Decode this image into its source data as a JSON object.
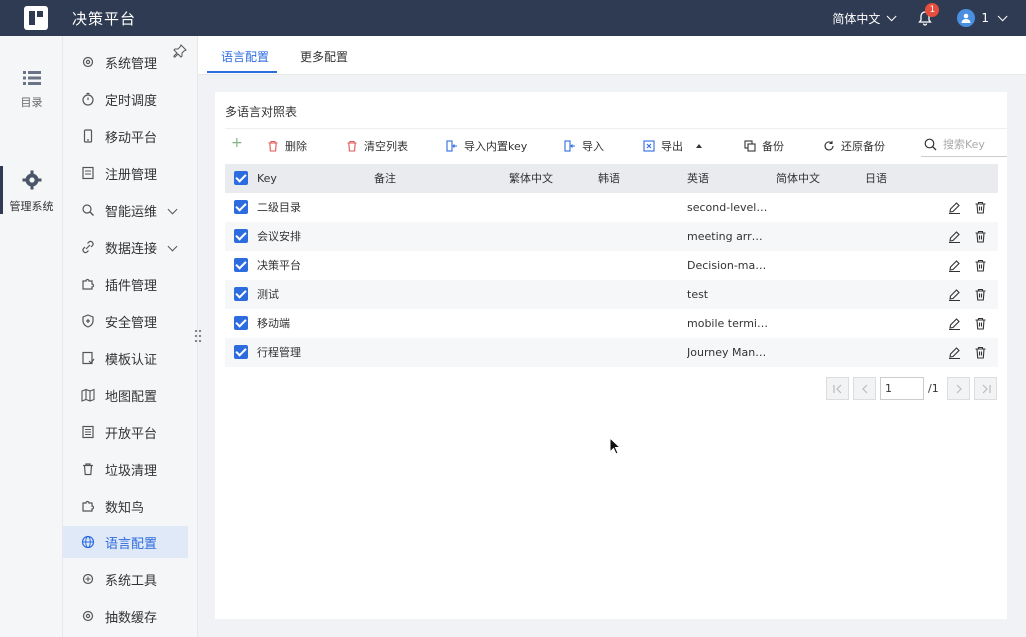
{
  "app": {
    "title": "决策平台"
  },
  "topbar": {
    "language": "简体中文",
    "notification_count": "1",
    "user_name": "1"
  },
  "rail": {
    "items": [
      {
        "label": "目录",
        "icon": "list-icon"
      },
      {
        "label": "管理系统",
        "icon": "gear-icon"
      }
    ]
  },
  "submenu": {
    "items": [
      {
        "label": "系统管理",
        "icon": "gear-icon"
      },
      {
        "label": "定时调度",
        "icon": "stopwatch-icon"
      },
      {
        "label": "移动平台",
        "icon": "mobile-icon"
      },
      {
        "label": "注册管理",
        "icon": "register-icon"
      },
      {
        "label": "智能运维",
        "icon": "ops-icon"
      },
      {
        "label": "数据连接",
        "icon": "link-icon"
      },
      {
        "label": "插件管理",
        "icon": "puzzle-icon"
      },
      {
        "label": "安全管理",
        "icon": "shield-icon"
      },
      {
        "label": "模板认证",
        "icon": "template-icon"
      },
      {
        "label": "地图配置",
        "icon": "map-icon"
      },
      {
        "label": "开放平台",
        "icon": "open-icon"
      },
      {
        "label": "垃圾清理",
        "icon": "trash-icon"
      },
      {
        "label": "数知鸟",
        "icon": "bird-icon"
      },
      {
        "label": "语言配置",
        "icon": "globe-icon"
      },
      {
        "label": "系统工具",
        "icon": "tool-icon"
      },
      {
        "label": "抽数缓存",
        "icon": "cache-icon"
      }
    ]
  },
  "tabs": [
    {
      "label": "语言配置"
    },
    {
      "label": "更多配置"
    }
  ],
  "panel": {
    "title": "多语言对照表"
  },
  "toolbar": {
    "add": "+",
    "delete": "删除",
    "clear": "清空列表",
    "import_builtin": "导入内置key",
    "import": "导入",
    "export": "导出",
    "backup": "备份",
    "restore": "还原备份",
    "search_placeholder": "搜索Key"
  },
  "table": {
    "columns": [
      "Key",
      "备注",
      "繁体中文",
      "韩语",
      "英语",
      "简体中文",
      "日语"
    ],
    "rows": [
      {
        "key": "二级目录",
        "en": "second-level …"
      },
      {
        "key": "会议安排",
        "en": "meeting arran…"
      },
      {
        "key": "决策平台",
        "en": "Decision-maki…"
      },
      {
        "key": "测试",
        "en": "test"
      },
      {
        "key": "移动端",
        "en": "mobile terminal"
      },
      {
        "key": "行程管理",
        "en": "Journey Mana…"
      }
    ]
  },
  "pager": {
    "current": "1",
    "total": "/1"
  }
}
